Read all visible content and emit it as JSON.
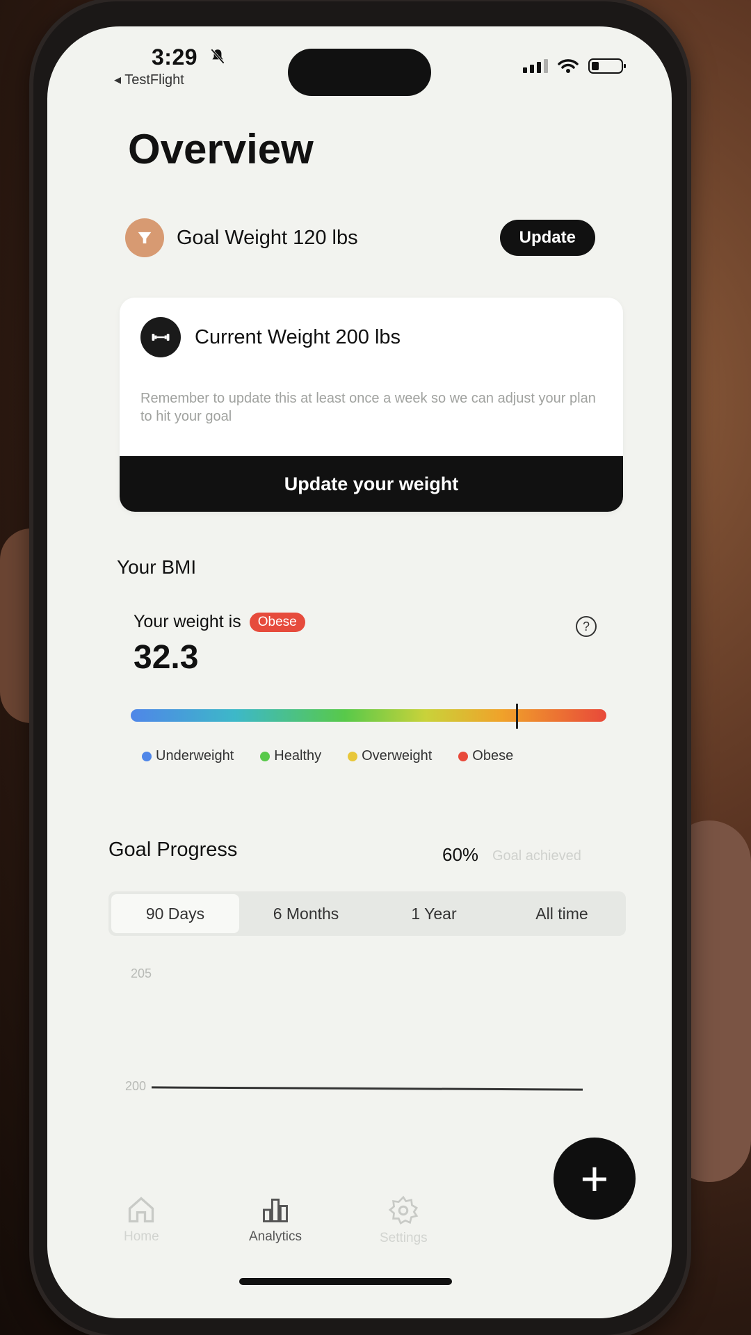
{
  "status_bar": {
    "time": "3:29",
    "back_label": "◂ TestFlight"
  },
  "page": {
    "title": "Overview"
  },
  "goal": {
    "text": "Goal Weight 120 lbs",
    "update_label": "Update"
  },
  "current_weight": {
    "text": "Current Weight  200 lbs",
    "note": "Remember to update this at least once a week so we can adjust your plan to hit your goal",
    "button_label": "Update your weight"
  },
  "bmi": {
    "heading": "Your BMI",
    "label": "Your weight is",
    "status": "Obese",
    "value": "32.3",
    "help": "?",
    "marker_fraction": 0.81,
    "legend": [
      {
        "label": "Underweight",
        "color": "#4f86e8"
      },
      {
        "label": "Healthy",
        "color": "#58c94a"
      },
      {
        "label": "Overweight",
        "color": "#e8c73a"
      },
      {
        "label": "Obese",
        "color": "#e8493a"
      }
    ]
  },
  "goal_progress": {
    "heading": "Goal Progress",
    "percent": "60%",
    "achieved_label": "Goal achieved",
    "tabs": [
      "90 Days",
      "6 Months",
      "1 Year",
      "All time"
    ],
    "active_tab": "90 Days",
    "y_ticks": [
      "205",
      "200"
    ]
  },
  "nav": {
    "home": "Home",
    "analytics": "Analytics",
    "settings": "Settings"
  },
  "fab": {
    "label": "+"
  }
}
